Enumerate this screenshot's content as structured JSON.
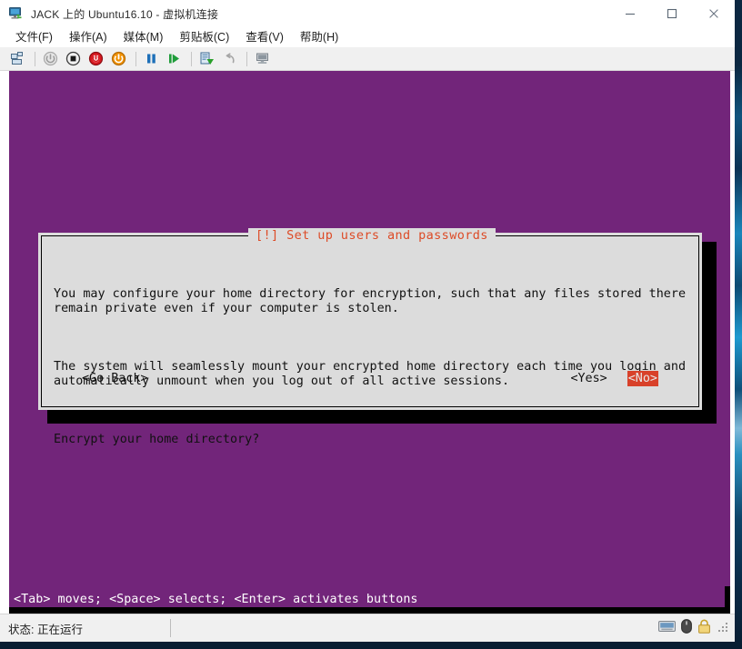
{
  "window": {
    "title": "JACK 上的 Ubuntu16.10 - 虚拟机连接",
    "icon": "vm-connect-icon",
    "controls": {
      "minimize": "minimize-icon",
      "maximize": "maximize-icon",
      "close": "close-icon"
    }
  },
  "menubar": {
    "items": [
      {
        "label": "文件(F)"
      },
      {
        "label": "操作(A)"
      },
      {
        "label": "媒体(M)"
      },
      {
        "label": "剪贴板(C)"
      },
      {
        "label": "查看(V)"
      },
      {
        "label": "帮助(H)"
      }
    ]
  },
  "toolbar": {
    "items": [
      {
        "name": "ctrl-alt-del-icon"
      },
      {
        "name": "start-icon"
      },
      {
        "name": "turn-off-icon"
      },
      {
        "name": "shut-down-icon"
      },
      {
        "name": "save-state-icon"
      },
      {
        "name": "pause-icon"
      },
      {
        "name": "reset-icon"
      },
      {
        "name": "checkpoint-icon"
      },
      {
        "name": "revert-icon"
      },
      {
        "name": "enhanced-session-icon"
      }
    ]
  },
  "vm": {
    "background_color": "#72257a",
    "dialog": {
      "title": "[!] Set up users and passwords",
      "title_color": "#dd4b27",
      "background_color": "#dcdcdc",
      "paragraphs": [
        "You may configure your home directory for encryption, such that any files stored there\nremain private even if your computer is stolen.",
        "The system will seamlessly mount your encrypted home directory each time you login and\nautomatically unmount when you log out of all active sessions.",
        "Encrypt your home directory?"
      ],
      "buttons": {
        "go_back": "<Go Back>",
        "yes": "<Yes>",
        "no": "<No>",
        "selected": "<No>",
        "selected_bg": "#d8412a",
        "selected_fg": "#e8e8e8"
      }
    },
    "hint": "<Tab> moves; <Space> selects; <Enter> activates buttons"
  },
  "statusbar": {
    "status": "状态: 正在运行",
    "icons": [
      {
        "name": "keyboard-icon"
      },
      {
        "name": "mouse-icon"
      },
      {
        "name": "lock-icon"
      }
    ]
  }
}
